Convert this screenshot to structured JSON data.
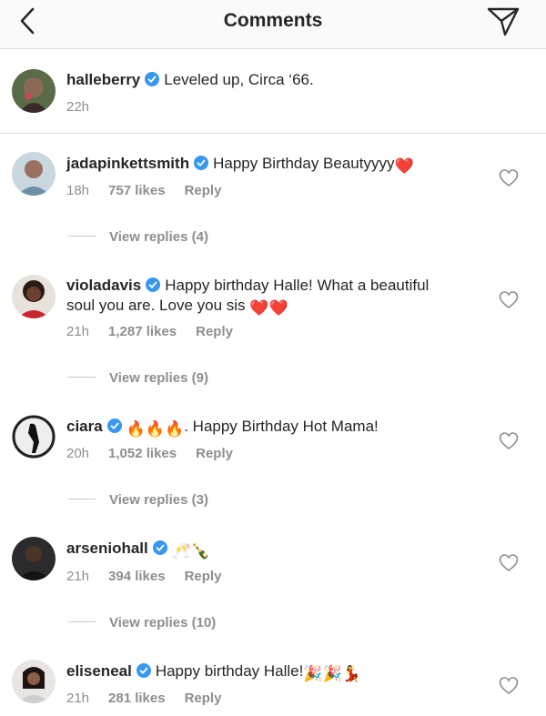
{
  "header": {
    "title": "Comments",
    "back_icon": "chevron-left-icon",
    "send_icon": "paper-plane-icon"
  },
  "caption": {
    "username": "halleberry",
    "text": "Leveled up, Circa ‘66.",
    "time": "22h"
  },
  "comments": [
    {
      "username": "jadapinkettsmith",
      "text": "Happy Birthday Beautyyyy",
      "emojis": "❤️",
      "time": "18h",
      "likes": "757 likes",
      "reply": "Reply",
      "view_replies": "View replies (4)"
    },
    {
      "username": "violadavis",
      "text": "Happy birthday Halle! What a beautiful",
      "text2": "soul you are. Love you sis",
      "emojis": "❤️❤️",
      "time": "21h",
      "likes": "1,287 likes",
      "reply": "Reply",
      "view_replies": "View replies (9)"
    },
    {
      "username": "ciara",
      "emojis": "🔥🔥🔥",
      "text": ". Happy Birthday Hot Mama!",
      "time": "20h",
      "likes": "1,052 likes",
      "reply": "Reply",
      "view_replies": "View replies (3)"
    },
    {
      "username": "arseniohall",
      "emojis": "🥂🍾",
      "time": "21h",
      "likes": "394 likes",
      "reply": "Reply",
      "view_replies": "View replies (10)"
    },
    {
      "username": "eliseneal",
      "text": "Happy birthday Halle!",
      "emojis": "🎉🎉💃",
      "time": "21h",
      "likes": "281 likes",
      "reply": "Reply"
    }
  ],
  "colors": {
    "text": "#262626",
    "muted": "#8e8e8e",
    "verified": "#3897f0",
    "heart_red": "#ed4956",
    "divider": "#dbdbdb"
  }
}
